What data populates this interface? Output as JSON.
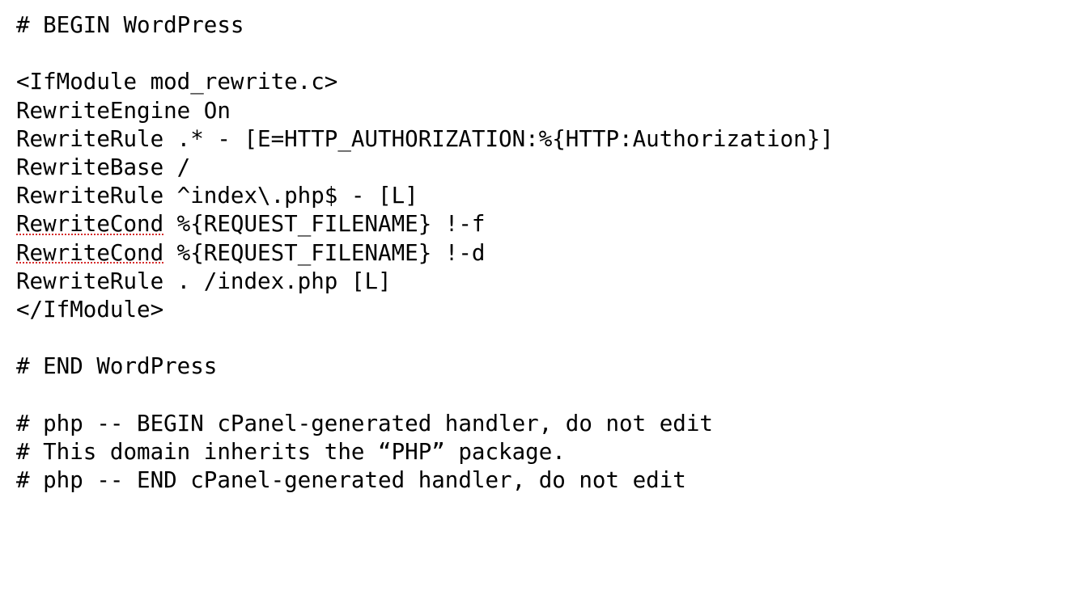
{
  "lines": [
    {
      "kind": "plain",
      "text": "# BEGIN WordPress"
    },
    {
      "kind": "blank"
    },
    {
      "kind": "plain",
      "text": "<IfModule mod_rewrite.c>"
    },
    {
      "kind": "plain",
      "text": "RewriteEngine On"
    },
    {
      "kind": "plain",
      "text": "RewriteRule .* - [E=HTTP_AUTHORIZATION:%{HTTP:Authorization}]"
    },
    {
      "kind": "plain",
      "text": "RewriteBase /"
    },
    {
      "kind": "plain",
      "text": "RewriteRule ^index\\.php$ - [L]"
    },
    {
      "kind": "spell",
      "spell": "RewriteCond",
      "rest": " %{REQUEST_FILENAME} !-f"
    },
    {
      "kind": "spell",
      "spell": "RewriteCond",
      "rest": " %{REQUEST_FILENAME} !-d"
    },
    {
      "kind": "plain",
      "text": "RewriteRule . /index.php [L]"
    },
    {
      "kind": "plain",
      "text": "</IfModule>"
    },
    {
      "kind": "blank"
    },
    {
      "kind": "plain",
      "text": "# END WordPress"
    },
    {
      "kind": "blank"
    },
    {
      "kind": "plain",
      "text": "# php -- BEGIN cPanel-generated handler, do not edit"
    },
    {
      "kind": "plain",
      "text": "# This domain inherits the “PHP” package."
    },
    {
      "kind": "plain",
      "text": "# php -- END cPanel-generated handler, do not edit"
    }
  ]
}
